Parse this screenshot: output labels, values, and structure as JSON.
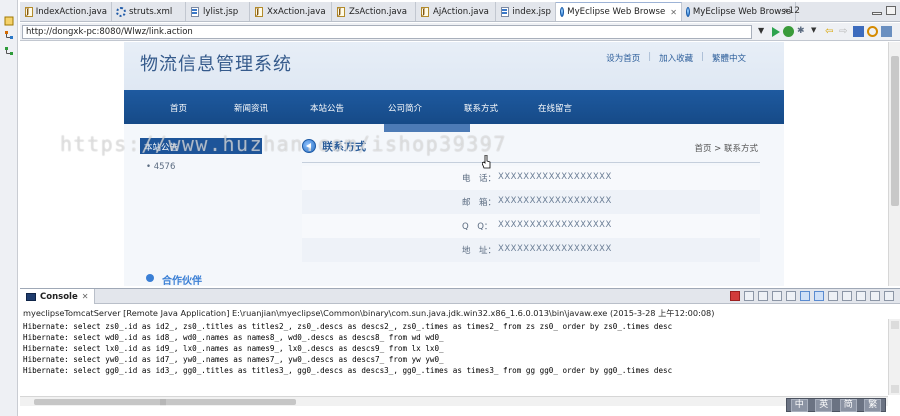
{
  "editor_tabs": [
    {
      "label": "IndexAction.java",
      "icon": "java-file-icon"
    },
    {
      "label": "struts.xml",
      "icon": "struts-config-icon"
    },
    {
      "label": "lylist.jsp",
      "icon": "jsp-file-icon"
    },
    {
      "label": "XxAction.java",
      "icon": "java-file-icon"
    },
    {
      "label": "ZsAction.java",
      "icon": "java-file-icon"
    },
    {
      "label": "AjAction.java",
      "icon": "java-file-icon"
    },
    {
      "label": "index.jsp",
      "icon": "jsp-file-icon"
    },
    {
      "label": "MyEclipse Web Browse",
      "icon": "web-browser-icon",
      "active": true
    },
    {
      "label": "MyEclipse Web Browse",
      "icon": "web-browser-icon"
    }
  ],
  "tab_overflow": "»12",
  "browser": {
    "url": "http://dongxk-pc:8080/Wlwz/link.action"
  },
  "site": {
    "title": "物流信息管理系统",
    "top_links": [
      "设为首页",
      "加入收藏",
      "繁體中文"
    ],
    "nav": [
      "首页",
      "新闻资讯",
      "本站公告",
      "公司简介",
      "联系方式",
      "在线留言"
    ],
    "sidebar_heading": "本站公告",
    "notice_items": [
      "4576"
    ],
    "contact_heading": "联系方式",
    "breadcrumb": "首页 > 联系方式",
    "contact_rows": [
      {
        "label": "电　话：",
        "value": "XXXXXXXXXXXXXXXXXX"
      },
      {
        "label": "邮　箱：",
        "value": "XXXXXXXXXXXXXXXXXX"
      },
      {
        "label": "Q　Q：",
        "value": "XXXXXXXXXXXXXXXXXX"
      },
      {
        "label": "地　址：",
        "value": "XXXXXXXXXXXXXXXXXX"
      }
    ],
    "partner_heading": "合作伙伴",
    "watermark": "https://www.huzhan.com/ishop39397"
  },
  "console": {
    "tab_label": "Console",
    "status": "myeclipseTomcatServer [Remote Java Application] E:\\ruanjian\\myeclipse\\Common\\binary\\com.sun.java.jdk.win32.x86_1.6.0.013\\bin\\javaw.exe (2015-3-28 上午12:00:08)",
    "lines": [
      "Hibernate: select zs0_.id as id2_, zs0_.titles as titles2_, zs0_.descs as descs2_, zs0_.times as times2_ from zs zs0_ order by zs0_.times desc",
      "Hibernate: select wd0_.id as id8_, wd0_.names as names8_, wd0_.descs as descs8_ from wd wd0_",
      "Hibernate: select lx0_.id as id9_, lx0_.names as names9_, lx0_.descs as descs9_ from lx lx0_",
      "Hibernate: select yw0_.id as id7_, yw0_.names as names7_, yw0_.descs as descs7_ from yw yw0_",
      "Hibernate: select gg0_.id as id3_, gg0_.titles as titles3_, gg0_.descs as descs3_, gg0_.times as times3_ from gg gg0_ order by gg0_.times desc"
    ]
  },
  "ime": [
    "中",
    "英",
    "简",
    "繁"
  ],
  "colors": {
    "nav_blue": "#1e5aa0",
    "site_title": "#365b8c",
    "link_blue": "#2b5d9a"
  }
}
